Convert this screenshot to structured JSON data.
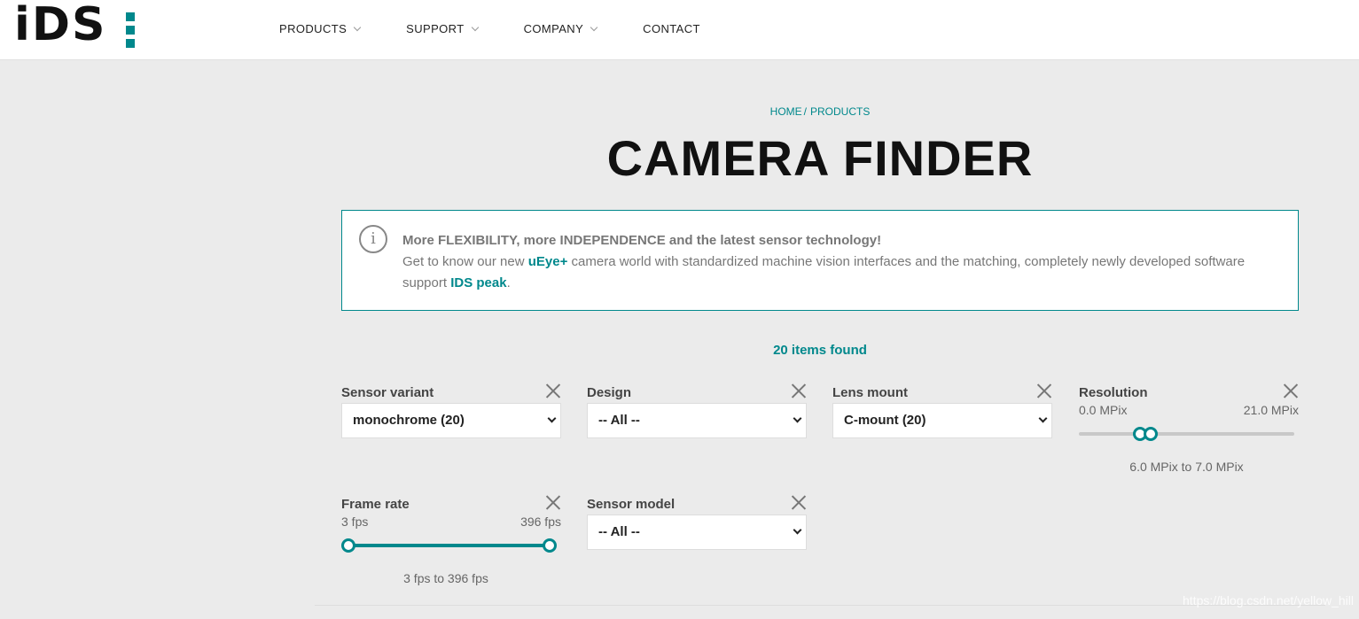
{
  "header": {
    "logo_text": "iDS",
    "nav": [
      {
        "label": "PRODUCTS",
        "has_menu": true
      },
      {
        "label": "SUPPORT",
        "has_menu": true
      },
      {
        "label": "COMPANY",
        "has_menu": true
      },
      {
        "label": "CONTACT",
        "has_menu": false
      }
    ]
  },
  "breadcrumb": {
    "home": "HOME",
    "sep": "/",
    "current": "PRODUCTS"
  },
  "title": "CAMERA FINDER",
  "info": {
    "icon": "info-icon",
    "headline": "More FLEXIBILITY, more INDEPENDENCE and the latest sensor technology!",
    "line_before": "Get to know our new ",
    "link1": "uEye+",
    "line_middle": " camera world with standardized machine vision interfaces and the matching, completely newly developed software support ",
    "link2": "IDS peak",
    "line_after": "."
  },
  "found": "20 items found",
  "filters": {
    "sensor_variant": {
      "label": "Sensor variant",
      "value": "monochrome (20)"
    },
    "design": {
      "label": "Design",
      "value": "-- All --"
    },
    "lens_mount": {
      "label": "Lens mount",
      "value": "C-mount (20)"
    },
    "resolution": {
      "label": "Resolution",
      "min": "0.0 MPix",
      "max": "21.0 MPix",
      "readout": "6.0 MPix to 7.0 MPix",
      "range_min": 0.0,
      "range_max": 21.0,
      "low": 6.0,
      "high": 7.0
    },
    "frame_rate": {
      "label": "Frame rate",
      "min": "3 fps",
      "max": "396 fps",
      "readout": "3 fps to 396 fps",
      "range_min": 3,
      "range_max": 396,
      "low": 3,
      "high": 396
    },
    "sensor_model": {
      "label": "Sensor model",
      "value": "-- All --"
    }
  },
  "watermark": "https://blog.csdn.net/yellow_hill"
}
